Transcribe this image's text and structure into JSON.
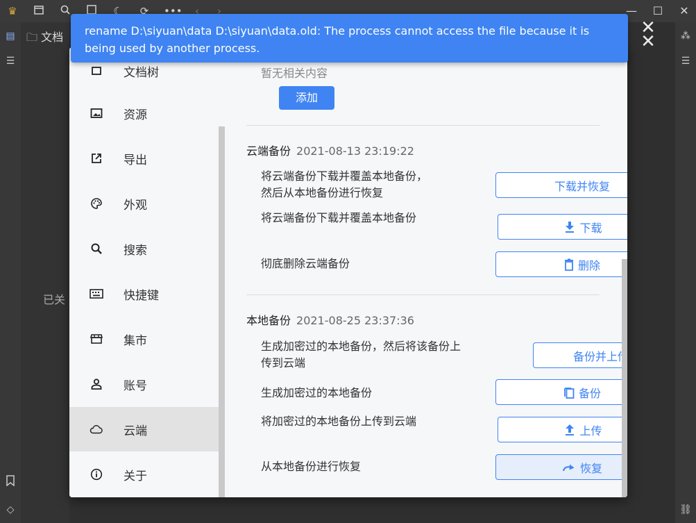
{
  "message": {
    "text": "rename D:\\siyuan\\data D:\\siyuan\\data.old: The process cannot access the file because it is being used by another process.",
    "close_icon": "close-icon"
  },
  "background": {
    "file_tree_label": "文档",
    "closed_hint": "已关"
  },
  "sidebar": {
    "items": [
      {
        "label": "文档树",
        "icon": "tree-icon"
      },
      {
        "label": "资源",
        "icon": "image-icon"
      },
      {
        "label": "导出",
        "icon": "export-icon"
      },
      {
        "label": "外观",
        "icon": "palette-icon"
      },
      {
        "label": "搜索",
        "icon": "search-icon"
      },
      {
        "label": "快捷键",
        "icon": "keyboard-icon"
      },
      {
        "label": "集市",
        "icon": "store-icon"
      },
      {
        "label": "账号",
        "icon": "account-icon"
      },
      {
        "label": "云端",
        "icon": "cloud-icon",
        "active": true
      },
      {
        "label": "关于",
        "icon": "info-icon"
      }
    ]
  },
  "content": {
    "no_content": "暂无相关内容",
    "add_label": "添加",
    "cloud": {
      "title": "云端备份",
      "timestamp": "2021-08-13 23:19:22",
      "rows": [
        {
          "desc": "将云端备份下载并覆盖本地备份，然后从本地备份进行恢复",
          "button": "下载并恢复"
        },
        {
          "desc": "将云端备份下载并覆盖本地备份",
          "button": "下载"
        },
        {
          "desc": "彻底删除云端备份",
          "button": "删除"
        }
      ]
    },
    "local": {
      "title": "本地备份",
      "timestamp": "2021-08-25 23:37:36",
      "rows": [
        {
          "desc": "生成加密过的本地备份，然后将该备份上传到云端",
          "button": "备份并上传"
        },
        {
          "desc": "生成加密过的本地备份",
          "button": "备份"
        },
        {
          "desc": "将加密过的本地备份上传到云端",
          "button": "上传"
        },
        {
          "desc": "从本地备份进行恢复",
          "button": "恢复"
        }
      ]
    }
  },
  "colors": {
    "accent": "#3f84f2",
    "sidebar_active": "#e2e2e2",
    "panel_bg": "#f5f7f9"
  }
}
